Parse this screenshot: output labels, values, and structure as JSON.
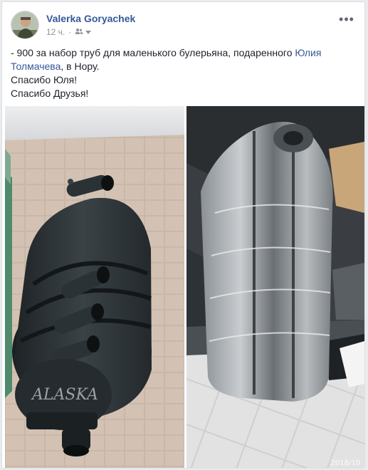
{
  "author": {
    "name": "Valerka Goryachek"
  },
  "meta": {
    "time": "12 ч.",
    "audience_icon": "friends-icon",
    "dropdown_icon": "chevron-down-icon"
  },
  "menu": {
    "more_icon": "more-dots-icon",
    "more_glyph": "•••"
  },
  "post": {
    "line1_prefix": "- 900 за набор труб для маленького булерьяна, подаренного ",
    "line1_link": "Юлия Толмачева",
    "line1_suffix": ", в Нору.",
    "line2": "Спасибо Юля!",
    "line3": "Спасибо Друзья!"
  },
  "photos": {
    "left_stove_brand": "ALASKA",
    "right_date_partial": "2018/10"
  },
  "colors": {
    "link": "#365899",
    "text": "#1d2129",
    "meta": "#90949c",
    "background": "#e9ebee"
  }
}
